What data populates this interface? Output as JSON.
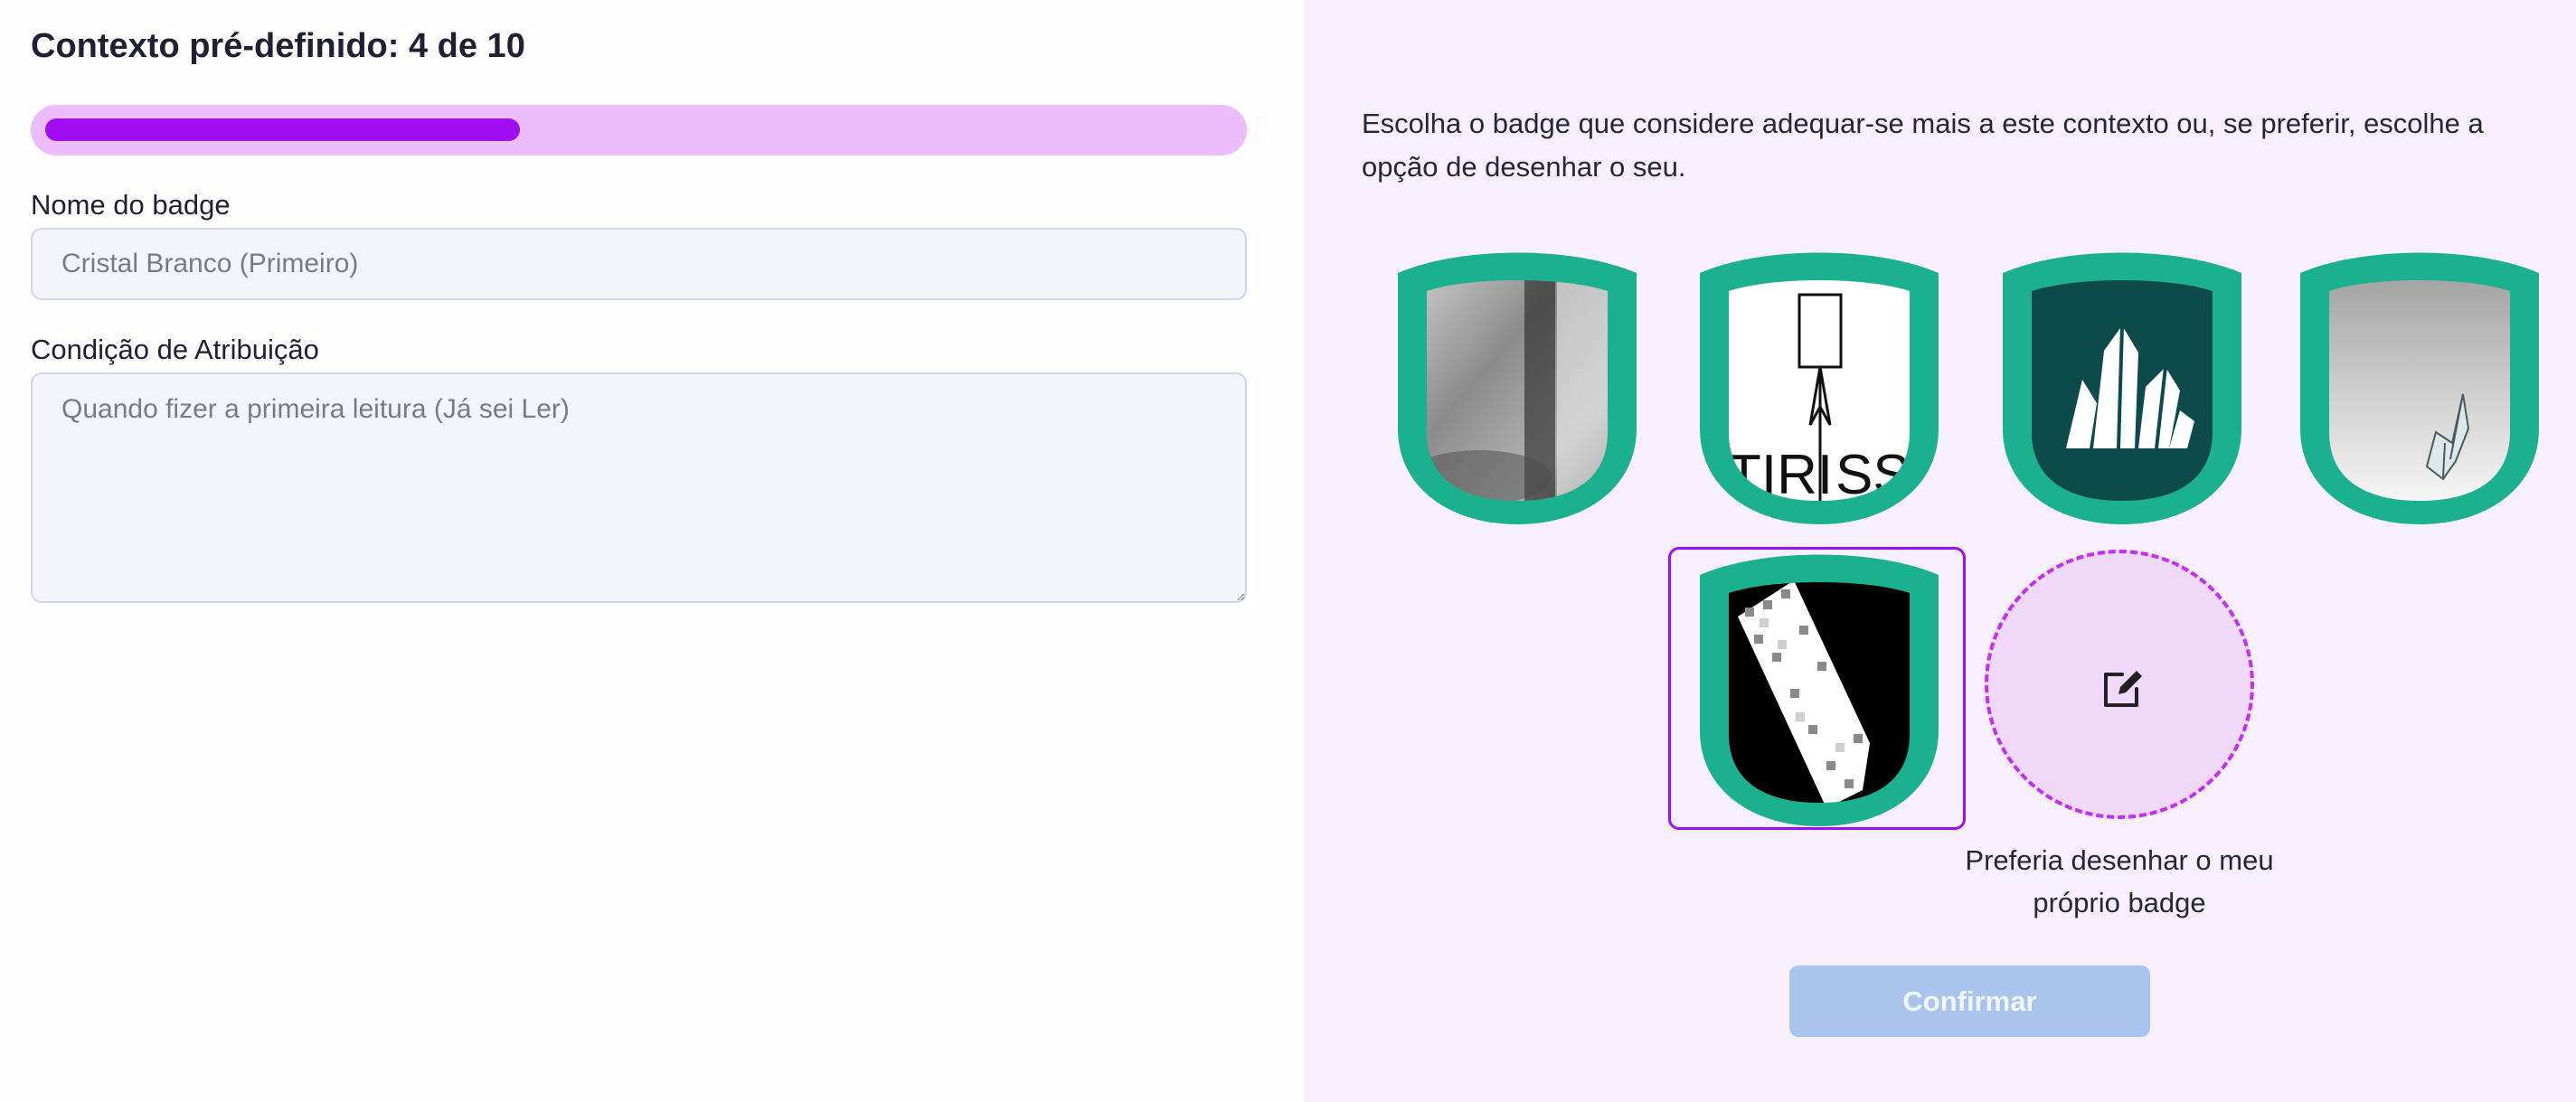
{
  "header": {
    "title": "Contexto pré-definido: 4 de 10",
    "progress_fraction": 0.4
  },
  "form": {
    "name_label": "Nome do badge",
    "name_value": "Cristal Branco (Primeiro)",
    "condition_label": "Condição de Atribuição",
    "condition_value": "Quando fizer a primeira leitura (Já sei Ler)"
  },
  "badge_picker": {
    "instructions": "Escolha o badge que considere adequar-se mais a este contexto ou, se preferir, escolhe a opção de desenhar o seu.",
    "badges": [
      {
        "icon": "grayscale-photo-badge-icon",
        "selected": false
      },
      {
        "icon": "sword-text-badge-icon",
        "selected": false
      },
      {
        "icon": "crystal-cluster-badge-icon",
        "selected": false
      },
      {
        "icon": "origami-crystal-badge-icon",
        "selected": false
      },
      {
        "icon": "pixel-crystal-badge-icon",
        "selected": true
      }
    ],
    "draw_option_label": "Preferia desenhar o meu próprio badge",
    "draw_icon": "edit-icon",
    "confirm_label": "Confirmar"
  },
  "colors": {
    "accent": "#a10df2",
    "progress_track": "#ecbcfb",
    "badge_rim": "#1bb18e",
    "badge_dark": "#0d4a4a",
    "confirm_disabled": "#aac4ed",
    "right_panel_bg": "#f8effd"
  }
}
